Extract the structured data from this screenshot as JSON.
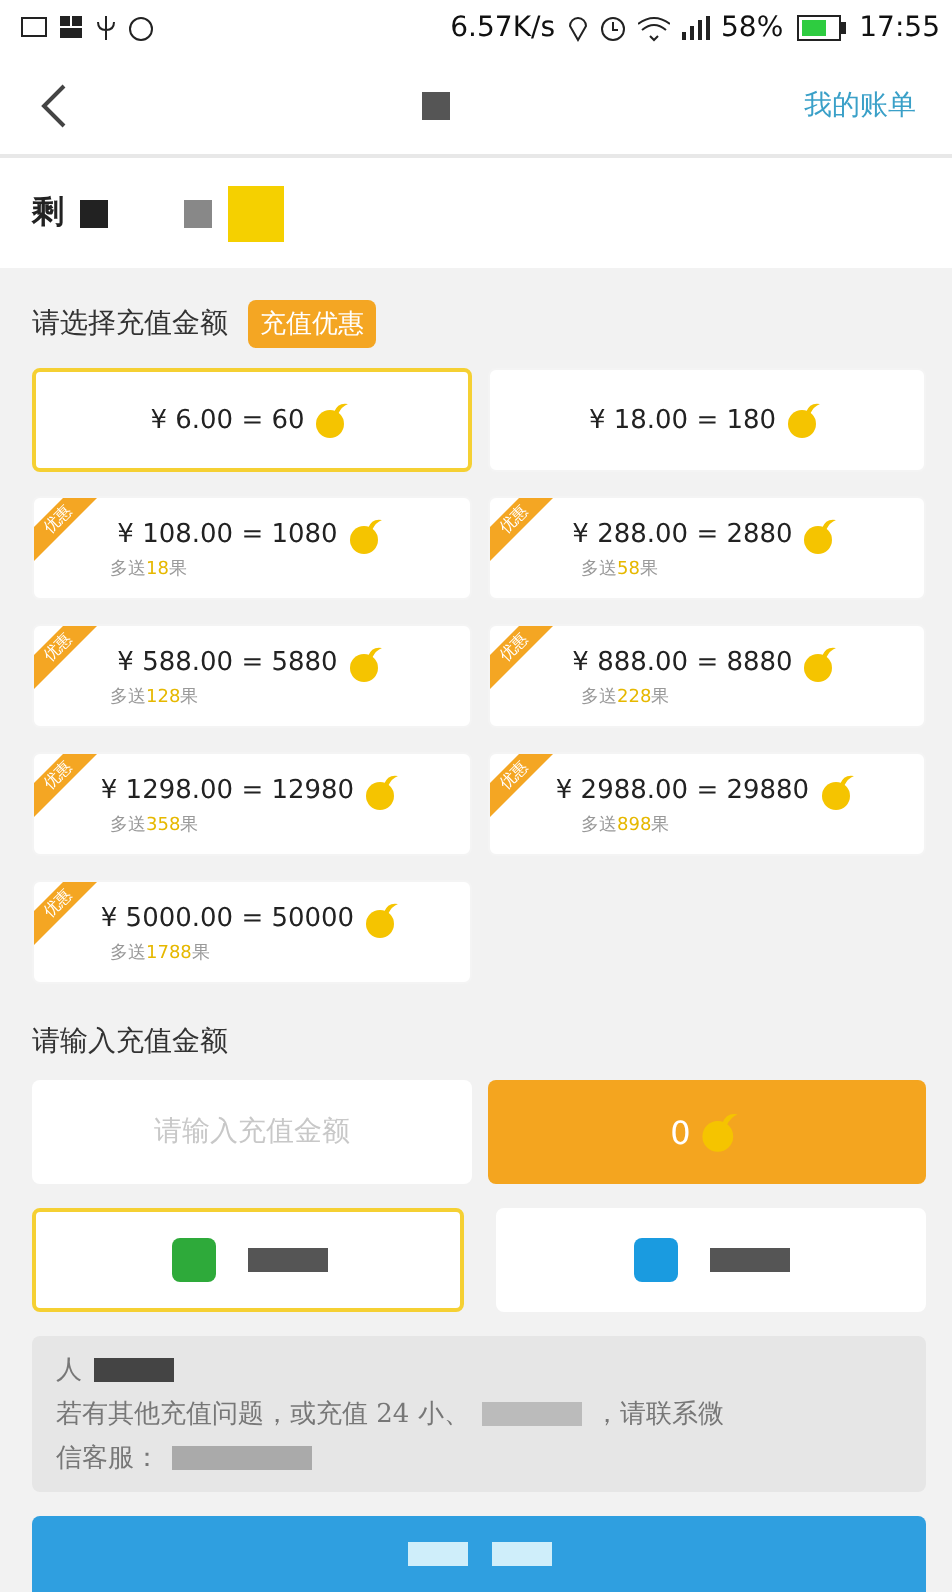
{
  "status_bar": {
    "speed": "6.57K/s",
    "battery": "58%",
    "time": "17:55"
  },
  "header": {
    "link": "我的账单"
  },
  "balance": {
    "label": "剩"
  },
  "select_section": {
    "title": "请选择充值金额",
    "badge": "充值优惠"
  },
  "options": [
    {
      "amount": "¥ 6.00 = 60",
      "promo": false,
      "selected": true
    },
    {
      "amount": "¥ 18.00 = 180",
      "promo": false,
      "selected": false
    },
    {
      "amount": "¥ 108.00 = 1080",
      "promo": true,
      "ribbon": "优惠",
      "bonus_prefix": "多送",
      "bonus": "18",
      "bonus_suffix": "果",
      "selected": false
    },
    {
      "amount": "¥ 288.00 = 2880",
      "promo": true,
      "ribbon": "优惠",
      "bonus_prefix": "多送",
      "bonus": "58",
      "bonus_suffix": "果",
      "selected": false
    },
    {
      "amount": "¥ 588.00 = 5880",
      "promo": true,
      "ribbon": "优惠",
      "bonus_prefix": "多送",
      "bonus": "128",
      "bonus_suffix": "果",
      "selected": false
    },
    {
      "amount": "¥ 888.00 = 8880",
      "promo": true,
      "ribbon": "优惠",
      "bonus_prefix": "多送",
      "bonus": "228",
      "bonus_suffix": "果",
      "selected": false
    },
    {
      "amount": "¥ 1298.00 = 12980",
      "promo": true,
      "ribbon": "优惠",
      "bonus_prefix": "多送",
      "bonus": "358",
      "bonus_suffix": "果",
      "selected": false
    },
    {
      "amount": "¥ 2988.00 = 29880",
      "promo": true,
      "ribbon": "优惠",
      "bonus_prefix": "多送",
      "bonus": "898",
      "bonus_suffix": "果",
      "selected": false
    },
    {
      "amount": "¥ 5000.00 = 50000",
      "promo": true,
      "ribbon": "优惠",
      "bonus_prefix": "多送",
      "bonus": "1788",
      "bonus_suffix": "果",
      "selected": false
    }
  ],
  "custom": {
    "label": "请输入充值金额",
    "placeholder": "请输入充值金额",
    "result": "0"
  },
  "payment_methods": [
    {
      "selected": true,
      "color": "#2eaa3a"
    },
    {
      "selected": false,
      "color": "#1a9be0"
    }
  ],
  "notice": {
    "heading": "人",
    "line_1_start": "若有其他充值问题，或充值 24 小、",
    "line_1_end": "，请联系微",
    "line_2": "信客服："
  }
}
